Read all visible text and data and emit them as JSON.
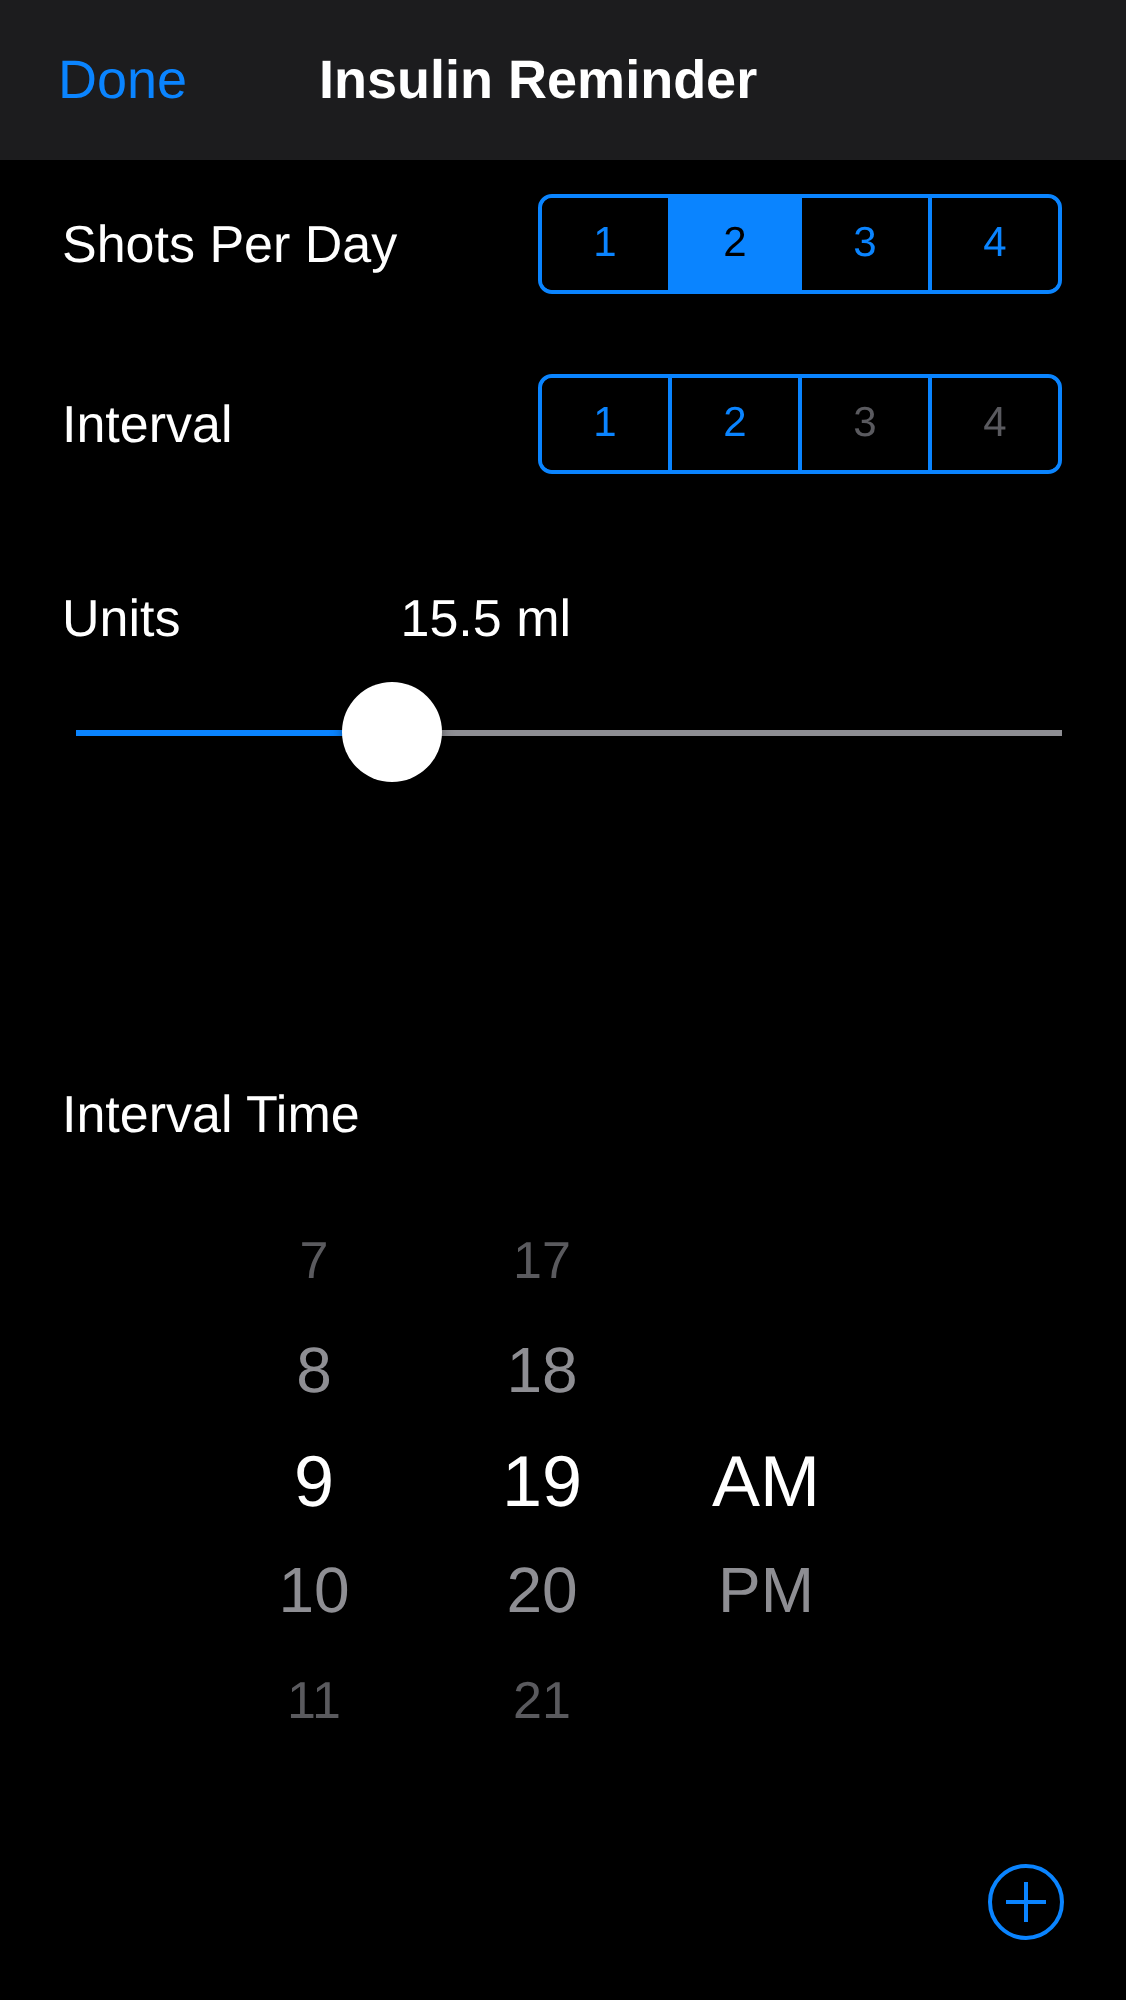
{
  "nav": {
    "done": "Done",
    "title": "Insulin Reminder"
  },
  "segment_rows": [
    {
      "label": "Shots Per Day",
      "segments": [
        {
          "label": "1",
          "selected": false,
          "disabled": false
        },
        {
          "label": "2",
          "selected": true,
          "disabled": false
        },
        {
          "label": "3",
          "selected": false,
          "disabled": false
        },
        {
          "label": "4",
          "selected": false,
          "disabled": false
        }
      ]
    },
    {
      "label": "Interval",
      "segments": [
        {
          "label": "1",
          "selected": false,
          "disabled": false
        },
        {
          "label": "2",
          "selected": false,
          "disabled": false
        },
        {
          "label": "3",
          "selected": false,
          "disabled": true
        },
        {
          "label": "4",
          "selected": false,
          "disabled": true
        }
      ]
    }
  ],
  "units": {
    "label": "Units",
    "reading": "15.5 ml",
    "level": 0.32
  },
  "interval_time": {
    "label": "Interval Time",
    "columns": [
      {
        "items": [
          {
            "label": "7",
            "selected": false
          },
          {
            "label": "8",
            "selected": false
          },
          {
            "label": "9",
            "selected": true
          },
          {
            "label": "10",
            "selected": false
          },
          {
            "label": "11",
            "selected": false
          }
        ]
      },
      {
        "items": [
          {
            "label": "17",
            "selected": false
          },
          {
            "label": "18",
            "selected": false
          },
          {
            "label": "19",
            "selected": true
          },
          {
            "label": "20",
            "selected": false
          },
          {
            "label": "21",
            "selected": false
          }
        ]
      },
      {
        "items": [
          {
            "label": "AM",
            "selected": true
          },
          {
            "label": "PM",
            "selected": false
          }
        ]
      }
    ]
  }
}
